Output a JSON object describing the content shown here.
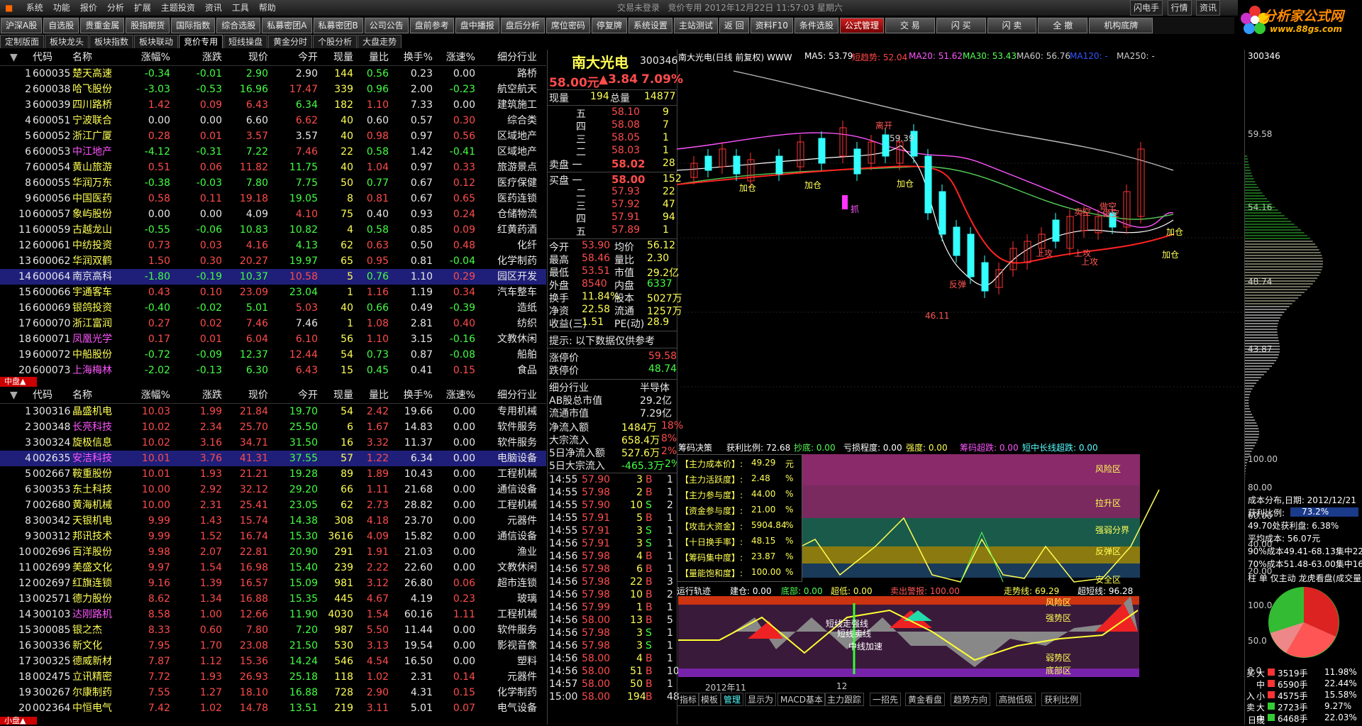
{
  "menu": [
    "系统",
    "功能",
    "报价",
    "分析",
    "扩展",
    "主题投资",
    "资讯",
    "工具",
    "帮助"
  ],
  "window_title": "交易未登录",
  "title_status": "竞价专用 2012年12月22日 11:57:03 星期六",
  "top_right": [
    "闪电手",
    "行情",
    "资讯"
  ],
  "toolbar": [
    "沪深A股",
    "自选股",
    "贵重金属",
    "股指期货",
    "国际指数",
    "综合选股",
    "私募密团A",
    "私募密团B",
    "公司公告",
    "盘前参考",
    "盘中播报",
    "盘后分析",
    "席位密码",
    "停复牌",
    "系统设置",
    "主站测试",
    "返 回",
    "资料F10",
    "条件选股",
    "公式管理",
    "交 易",
    "闪 买",
    "闪 卖",
    "全 撤",
    "机构底牌"
  ],
  "logo": {
    "name": "分析家公式网",
    "url": "www.88gs.com"
  },
  "tabs": [
    "定制版面",
    "板块龙头",
    "板块指数",
    "板块联动",
    "竞价专用",
    "短线操盘",
    "黄金分时",
    "个股分析",
    "大盘走势"
  ],
  "table_headers": [
    "代码",
    "名称",
    "涨幅%",
    "涨跌",
    "现价",
    "今开",
    "现量",
    "量比",
    "换手%",
    "涨速%",
    "细分行业"
  ],
  "table1": [
    [
      "1",
      "600035",
      "楚天高速",
      "-0.34",
      "-0.01",
      "2.90",
      "2.90",
      "144",
      "0.56",
      "0.23",
      "0.00",
      "路桥"
    ],
    [
      "2",
      "600038",
      "哈飞股份",
      "-3.03",
      "-0.53",
      "16.96",
      "17.47",
      "339",
      "0.96",
      "2.00",
      "-0.23",
      "航空航天"
    ],
    [
      "3",
      "600039",
      "四川路桥",
      "1.42",
      "0.09",
      "6.43",
      "6.34",
      "182",
      "1.10",
      "7.33",
      "0.00",
      "建筑施工"
    ],
    [
      "4",
      "600051",
      "宁波联合",
      "0.00",
      "0.00",
      "6.60",
      "6.62",
      "40",
      "0.60",
      "0.57",
      "0.30",
      "综合类"
    ],
    [
      "5",
      "600052",
      "浙江广厦",
      "0.28",
      "0.01",
      "3.57",
      "3.57",
      "40",
      "0.98",
      "0.97",
      "0.56",
      "区域地产"
    ],
    [
      "6",
      "600053",
      "中江地产",
      "-4.12",
      "-0.31",
      "7.22",
      "7.46",
      "22",
      "0.58",
      "1.42",
      "-0.41",
      "区域地产"
    ],
    [
      "7",
      "600054",
      "黄山旅游",
      "0.51",
      "0.06",
      "11.82",
      "11.75",
      "40",
      "1.04",
      "0.97",
      "0.33",
      "旅游景点"
    ],
    [
      "8",
      "600055",
      "华润万东",
      "-0.38",
      "-0.03",
      "7.80",
      "7.75",
      "50",
      "0.77",
      "0.67",
      "0.12",
      "医疗保健"
    ],
    [
      "9",
      "600056",
      "中国医药",
      "0.58",
      "0.11",
      "19.18",
      "19.05",
      "8",
      "0.81",
      "0.67",
      "0.65",
      "医药连锁"
    ],
    [
      "10",
      "600057",
      "象屿股份",
      "0.00",
      "0.00",
      "4.09",
      "4.10",
      "75",
      "0.40",
      "0.93",
      "0.24",
      "仓储物流"
    ],
    [
      "11",
      "600059",
      "古越龙山",
      "-0.55",
      "-0.06",
      "10.83",
      "10.82",
      "4",
      "0.58",
      "0.85",
      "0.09",
      "红黄药酒"
    ],
    [
      "12",
      "600061",
      "中纺投资",
      "0.73",
      "0.03",
      "4.16",
      "4.13",
      "62",
      "0.63",
      "0.50",
      "0.48",
      "化纤"
    ],
    [
      "13",
      "600062",
      "华润双鹤",
      "1.50",
      "0.30",
      "20.27",
      "19.97",
      "65",
      "0.95",
      "0.81",
      "-0.04",
      "化学制药"
    ],
    [
      "14",
      "600064",
      "南京高科",
      "-1.80",
      "-0.19",
      "10.37",
      "10.58",
      "5",
      "0.76",
      "1.10",
      "0.29",
      "园区开发"
    ],
    [
      "15",
      "600066",
      "宇通客车",
      "0.43",
      "0.10",
      "23.09",
      "23.04",
      "1",
      "1.16",
      "1.19",
      "0.34",
      "汽车整车"
    ],
    [
      "16",
      "600069",
      "银鸽投资",
      "-0.40",
      "-0.02",
      "5.01",
      "5.03",
      "40",
      "0.66",
      "0.49",
      "-0.39",
      "造纸"
    ],
    [
      "17",
      "600070",
      "浙江富润",
      "0.27",
      "0.02",
      "7.46",
      "7.46",
      "1",
      "1.08",
      "2.81",
      "0.40",
      "纺织"
    ],
    [
      "18",
      "600071",
      "凤凰光学",
      "0.17",
      "0.01",
      "6.04",
      "6.10",
      "56",
      "1.10",
      "3.15",
      "-0.16",
      "文教休闲"
    ],
    [
      "19",
      "600072",
      "中船股份",
      "-0.72",
      "-0.09",
      "12.37",
      "12.44",
      "54",
      "0.73",
      "0.87",
      "-0.08",
      "船舶"
    ],
    [
      "20",
      "600073",
      "上海梅林",
      "-2.02",
      "-0.13",
      "6.30",
      "6.43",
      "15",
      "0.45",
      "0.41",
      "0.15",
      "食品"
    ]
  ],
  "section2_label": "中盘▲",
  "section3_label": "小盘▲",
  "table2": [
    [
      "1",
      "300316",
      "晶盛机电",
      "10.03",
      "1.99",
      "21.84",
      "19.70",
      "54",
      "2.42",
      "19.66",
      "0.00",
      "专用机械"
    ],
    [
      "2",
      "300348",
      "长亮科技",
      "10.02",
      "2.34",
      "25.70",
      "25.50",
      "6",
      "1.67",
      "14.83",
      "0.00",
      "软件服务"
    ],
    [
      "3",
      "300324",
      "旋极信息",
      "10.02",
      "3.16",
      "34.71",
      "31.50",
      "16",
      "3.32",
      "11.37",
      "0.00",
      "软件服务"
    ],
    [
      "4",
      "002635",
      "安洁科技",
      "10.01",
      "3.76",
      "41.31",
      "37.55",
      "57",
      "1.22",
      "6.34",
      "0.00",
      "电脑设备"
    ],
    [
      "5",
      "002667",
      "鞍重股份",
      "10.01",
      "1.93",
      "21.21",
      "19.28",
      "89",
      "1.89",
      "10.43",
      "0.00",
      "工程机械"
    ],
    [
      "6",
      "300353",
      "东土科技",
      "10.00",
      "2.92",
      "32.12",
      "29.20",
      "66",
      "1.11",
      "21.68",
      "0.00",
      "通信设备"
    ],
    [
      "7",
      "002680",
      "黄海机械",
      "10.00",
      "2.31",
      "25.41",
      "23.05",
      "62",
      "2.73",
      "28.82",
      "0.00",
      "工程机械"
    ],
    [
      "8",
      "300342",
      "天银机电",
      "9.99",
      "1.43",
      "15.74",
      "14.38",
      "308",
      "4.18",
      "23.70",
      "0.00",
      "元器件"
    ],
    [
      "9",
      "300312",
      "邦讯技术",
      "9.99",
      "1.52",
      "16.74",
      "15.30",
      "3616",
      "4.09",
      "15.82",
      "0.00",
      "通信设备"
    ],
    [
      "10",
      "002696",
      "百洋股份",
      "9.98",
      "2.07",
      "22.81",
      "20.90",
      "291",
      "1.91",
      "21.03",
      "0.00",
      "渔业"
    ],
    [
      "11",
      "002699",
      "美盛文化",
      "9.97",
      "1.54",
      "16.98",
      "15.40",
      "239",
      "2.22",
      "22.60",
      "0.00",
      "文教休闲"
    ],
    [
      "12",
      "002697",
      "红旗连锁",
      "9.16",
      "1.39",
      "16.57",
      "15.09",
      "981",
      "3.12",
      "26.80",
      "0.06",
      "超市连锁"
    ],
    [
      "13",
      "002571",
      "德力股份",
      "8.62",
      "1.34",
      "16.88",
      "15.35",
      "445",
      "4.67",
      "4.19",
      "0.23",
      "玻璃"
    ],
    [
      "14",
      "300103",
      "达刚路机",
      "8.58",
      "1.00",
      "12.66",
      "11.90",
      "4030",
      "1.54",
      "60.16",
      "1.11",
      "工程机械"
    ],
    [
      "15",
      "300085",
      "银之杰",
      "8.33",
      "0.60",
      "7.80",
      "7.20",
      "987",
      "5.50",
      "11.44",
      "0.00",
      "软件服务"
    ],
    [
      "16",
      "300336",
      "新文化",
      "7.95",
      "1.70",
      "23.08",
      "21.50",
      "530",
      "3.13",
      "19.54",
      "0.00",
      "影视音像"
    ],
    [
      "17",
      "300325",
      "德威新材",
      "7.87",
      "1.12",
      "15.36",
      "14.24",
      "546",
      "4.54",
      "16.50",
      "0.00",
      "塑料"
    ],
    [
      "18",
      "002475",
      "立讯精密",
      "7.72",
      "1.93",
      "26.93",
      "25.18",
      "118",
      "1.02",
      "2.31",
      "0.14",
      "元器件"
    ],
    [
      "19",
      "300267",
      "尔康制药",
      "7.55",
      "1.27",
      "18.10",
      "16.88",
      "728",
      "2.90",
      "4.31",
      "0.15",
      "化学制药"
    ],
    [
      "20",
      "002364",
      "中恒电气",
      "7.42",
      "1.02",
      "14.78",
      "13.51",
      "219",
      "3.11",
      "5.01",
      "0.07",
      "电气设备"
    ]
  ],
  "quote": {
    "name": "南大光电",
    "code": "300346",
    "price": "58.00元",
    "change": "▲3.84",
    "pct": "7.09%",
    "xianliang_label": "现量",
    "xianliang": "194",
    "zongliang_label": "总量",
    "zongliang": "14877",
    "sell": [
      [
        "五",
        "58.10",
        "9"
      ],
      [
        "四",
        "58.08",
        "7"
      ],
      [
        "三",
        "58.05",
        "1"
      ],
      [
        "二",
        "58.03",
        "1"
      ],
      [
        "卖盘 一",
        "58.02",
        "28"
      ]
    ],
    "buy": [
      [
        "买盘 一",
        "58.00",
        "152"
      ],
      [
        "二",
        "57.93",
        "22"
      ],
      [
        "三",
        "57.92",
        "47"
      ],
      [
        "四",
        "57.91",
        "94"
      ],
      [
        "五",
        "57.89",
        "1"
      ]
    ],
    "stats": [
      [
        "今开",
        "53.90",
        "均价",
        "56.12"
      ],
      [
        "最高",
        "58.46",
        "量比",
        "2.30"
      ],
      [
        "最低",
        "53.51",
        "市值",
        "29.2亿"
      ],
      [
        "外盘",
        "8540",
        "内盘",
        "6337"
      ],
      [
        "换手",
        "11.84%",
        "股本",
        "5027万"
      ],
      [
        "净资",
        "22.58",
        "流通",
        "1257万"
      ],
      [
        "收益(三)",
        "1.51",
        "PE(动)",
        "28.9"
      ]
    ],
    "hint": "提示: 以下数据仅供参考",
    "limit_up_label": "涨停价",
    "limit_up": "59.58",
    "limit_down_label": "跌停价",
    "limit_down": "48.74",
    "info": [
      [
        "细分行业",
        "半导体"
      ],
      [
        "AB股总市值",
        "29.2亿"
      ],
      [
        "流通市值",
        "7.29亿"
      ]
    ],
    "flows": [
      [
        "净流入额",
        "1484万",
        "18%"
      ],
      [
        "大宗流入",
        "658.4万",
        "8%"
      ],
      [
        "5日净流入额",
        "527.6万",
        "2%"
      ],
      [
        "5日大宗流入",
        "-465.3万",
        "-2%"
      ]
    ],
    "ticks": [
      [
        "14:55",
        "57.90",
        "3",
        "B",
        "1"
      ],
      [
        "14:55",
        "57.98",
        "2",
        "B",
        "1"
      ],
      [
        "14:55",
        "57.90",
        "10",
        "S",
        "2"
      ],
      [
        "14:55",
        "57.91",
        "5",
        "B",
        "1"
      ],
      [
        "14:55",
        "57.91",
        "3",
        "S",
        "1"
      ],
      [
        "14:56",
        "57.91",
        "3",
        "S",
        "1"
      ],
      [
        "14:56",
        "57.98",
        "4",
        "B",
        "1"
      ],
      [
        "14:56",
        "57.98",
        "6",
        "B",
        "1"
      ],
      [
        "14:56",
        "57.98",
        "22",
        "B",
        "3"
      ],
      [
        "14:56",
        "57.98",
        "10",
        "B",
        "2"
      ],
      [
        "14:56",
        "57.99",
        "1",
        "B",
        "1"
      ],
      [
        "14:56",
        "58.00",
        "13",
        "B",
        "5"
      ],
      [
        "14:56",
        "57.98",
        "3",
        "S",
        "1"
      ],
      [
        "14:56",
        "57.98",
        "3",
        "S",
        "1"
      ],
      [
        "14:56",
        "58.00",
        "4",
        "B",
        "1"
      ],
      [
        "14:56",
        "58.00",
        "51",
        "B",
        "10"
      ],
      [
        "14:57",
        "58.00",
        "50",
        "B",
        "1"
      ],
      [
        "15:00",
        "58.00",
        "194",
        "B",
        "48"
      ]
    ]
  },
  "chart": {
    "title": "南大光电(日线 前复权) WWW",
    "ma": [
      [
        "MA5: 53.79",
        "#ffffff"
      ],
      [
        "短趋势: 52.04",
        "#ff4444"
      ],
      [
        "MA20: 51.62",
        "#ff55ff"
      ],
      [
        "MA30: 53.43",
        "#55ff55"
      ],
      [
        "MA60: 56.76",
        "#cccccc"
      ],
      [
        "MA120: -",
        "#3355ff"
      ],
      [
        "MA250: -",
        "#cccccc"
      ]
    ],
    "price_axis": [
      "59.58",
      "54.16",
      "48.74",
      "43.87"
    ],
    "annotations": {
      "high_label": "离开",
      "high_price": "59.39",
      "low_price": "46.11",
      "add1": "加仓",
      "add2": "加仓",
      "add3": "加仓",
      "add4": "加仓",
      "add5": "加仓",
      "catch": "抓",
      "top1": "卖空",
      "top2": "做空",
      "b1": "上攻",
      "b2": "上攻",
      "b3": "反弹",
      "b4": "上攻",
      "b5": "做空"
    },
    "panel2_header": [
      [
        "筹码决策",
        "#ffffff"
      ],
      [
        "获利比例: 72.68",
        "#ffffff"
      ],
      [
        "抄底: 0.00",
        "#55ff55"
      ],
      [
        "亏损程度: 0.00",
        "#ffffff"
      ],
      [
        "强度: 0.00",
        "#ffff55"
      ],
      [
        "筹码超跌: 0.00",
        "#ff55ff"
      ],
      [
        "短中长线超跌: 0.00",
        "#55ffff"
      ]
    ],
    "panel2_axis": [
      "100.00",
      "80.00",
      "60.00",
      "40.00",
      "20.00"
    ],
    "panel2_info": [
      [
        "【主力成本价】:",
        "49.29",
        "元"
      ],
      [
        "【主力活跃度】:",
        "2.48",
        "%"
      ],
      [
        "【主力参与度】:",
        "44.00",
        "%"
      ],
      [
        "【资金参与度】:",
        "21.00",
        "%"
      ],
      [
        "【攻击大资金】:",
        "5904.84",
        "%"
      ],
      [
        "【十日换手率】:",
        "48.15",
        "%"
      ],
      [
        "【筹码集中度】:",
        "23.87",
        "%"
      ],
      [
        "【量能饱和度】:",
        "100.00",
        "%"
      ]
    ],
    "panel2_zones": [
      "风险区",
      "拉升区",
      "强弱分界",
      "反弹区",
      "安全区"
    ],
    "panel3_header": [
      [
        "运行轨迹",
        "#ffffff"
      ],
      [
        "建仓: 0.00",
        "#ffffff"
      ],
      [
        "底部: 0.00",
        "#55ff55"
      ],
      [
        "超低: 0.00",
        "#ffff55"
      ],
      [
        "卖出警报: 100.00",
        "#ff5555"
      ],
      [
        "走势线: 69.29",
        "#ffff55"
      ],
      [
        "超短线: 96.28",
        "#ffffff"
      ]
    ],
    "panel3_axis": [
      "100.0",
      "50.0",
      "0.0"
    ],
    "panel3_zones": [
      "风险区",
      "强势区",
      "弱势区",
      "底部区"
    ],
    "panel3_labels": [
      "短线走强线",
      "短线卖线",
      "中线加速"
    ],
    "date_labels": [
      "2012年11",
      "12"
    ],
    "bottom_tabs": [
      "指标",
      "模板",
      "管理",
      "显示为",
      "MACD基本",
      "主力跟踪",
      "一招先",
      "黄金看盘",
      "趋势方向",
      "高抛低吸",
      "获利比例"
    ]
  },
  "side": {
    "code": "300346",
    "cost_title": "成本分布,日期: 2012/12/21",
    "profit_label": "获利比例:",
    "profit": "73.2%",
    "rows": [
      "49.70处获利盘: 6.38%",
      "平均成本: 56.07元",
      "90%成本49.41-68.13集中22.3",
      "70%成本51.48-63.00集中16.3"
    ],
    "tabs": "柱 单 仅主动 龙虎看盘(成交量)",
    "flows": [
      [
        "买",
        "大",
        "3519手",
        "11.98%",
        "#ff3333"
      ],
      [
        "",
        "中",
        "6590手",
        "22.44%",
        "#ff3333"
      ],
      [
        "入",
        "小",
        "4575手",
        "15.58%",
        "#ff3333"
      ],
      [
        "卖",
        "大",
        "2723手",
        "9.27%",
        "#33cc33"
      ],
      [
        "",
        "中",
        "6468手",
        "22.03%",
        "#33cc33"
      ]
    ],
    "bottom": "日线"
  }
}
